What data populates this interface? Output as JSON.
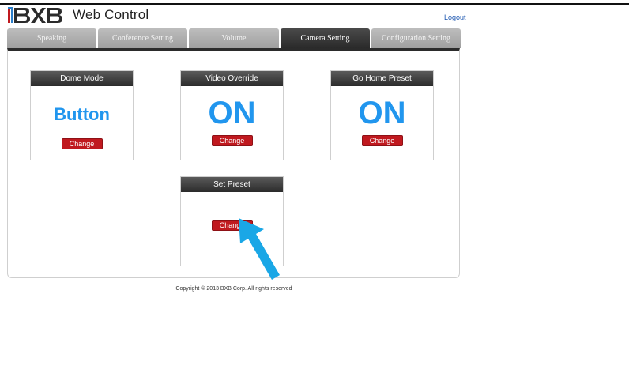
{
  "app": {
    "logo_text": "BXB",
    "title": "Web Control",
    "logout_label": "Logout"
  },
  "tabs": [
    {
      "label": "Speaking",
      "active": false
    },
    {
      "label": "Conference Setting",
      "active": false
    },
    {
      "label": "Volume",
      "active": false
    },
    {
      "label": "Camera Setting",
      "active": true
    },
    {
      "label": "Configuration Setting",
      "active": false
    }
  ],
  "cards": {
    "dome_mode": {
      "title": "Dome Mode",
      "value": "Button",
      "button": "Change"
    },
    "video_override": {
      "title": "Video Override",
      "value": "ON",
      "button": "Change"
    },
    "go_home_preset": {
      "title": "Go Home Preset",
      "value": "ON",
      "button": "Change"
    },
    "set_preset": {
      "title": "Set Preset",
      "button": "Change"
    }
  },
  "footer": {
    "copyright": "Copyright © 2013 BXB Corp. All rights reserved"
  },
  "colors": {
    "accent_value": "#2196ee",
    "button_red": "#c0191f",
    "active_tab": "#333333",
    "arrow": "#1aa7e6"
  }
}
